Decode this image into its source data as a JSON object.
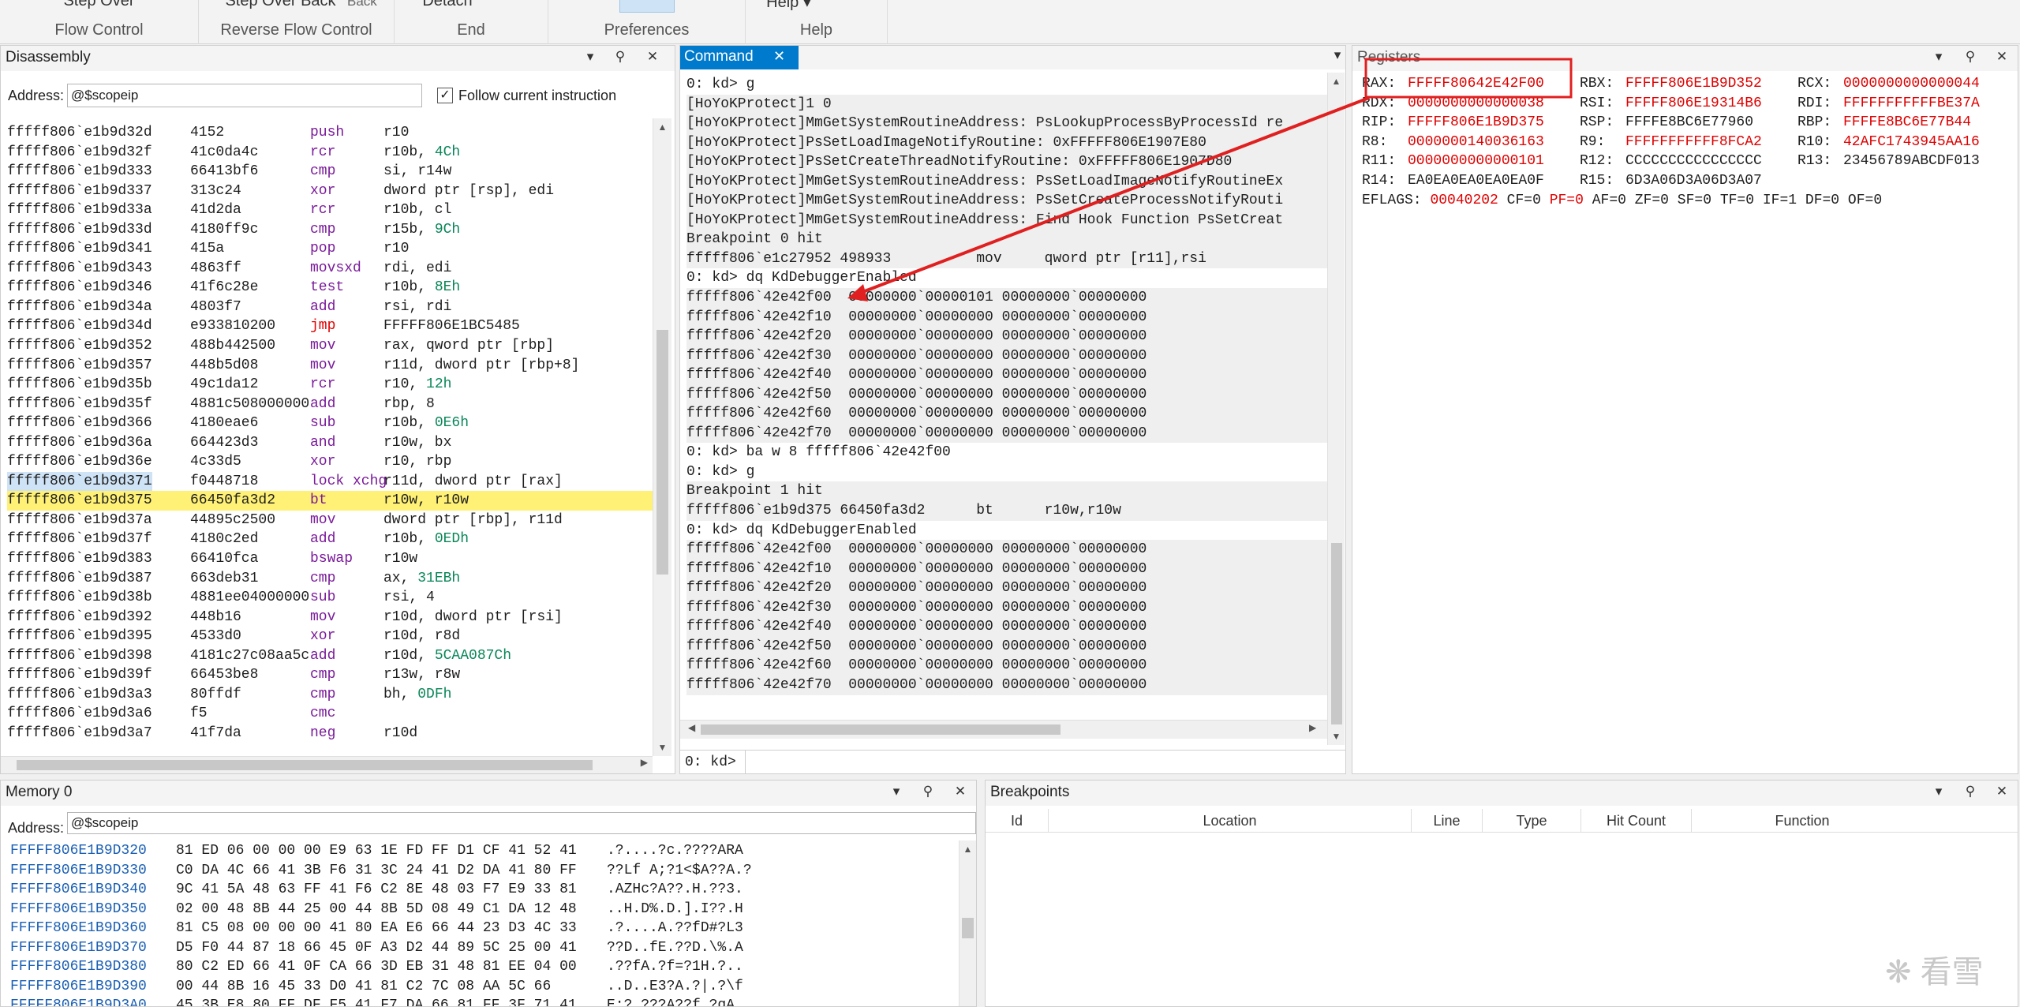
{
  "ribbon": {
    "groups": [
      {
        "top": "Step Over",
        "caption": "Flow Control"
      },
      {
        "top": "Step Over Back",
        "caption": "Reverse Flow Control"
      },
      {
        "top": "Detach",
        "caption": "End"
      },
      {
        "top": "",
        "caption": "Preferences"
      },
      {
        "top": "Help",
        "caption": "Help"
      }
    ],
    "back_label": "Back"
  },
  "disassembly": {
    "title": "Disassembly",
    "address_label": "Address:",
    "address_value": "@$scopeip",
    "follow_label": "Follow current instruction",
    "rows": [
      {
        "a": "fffff806`e1b9d32d",
        "b": "4152",
        "m": "push",
        "o": "r10",
        "h": "",
        "k": "p"
      },
      {
        "a": "fffff806`e1b9d32f",
        "b": "41c0da4c",
        "m": "rcr",
        "o": "r10b, ",
        "h": "4Ch",
        "k": "p"
      },
      {
        "a": "fffff806`e1b9d333",
        "b": "66413bf6",
        "m": "cmp",
        "o": "si, r14w",
        "h": "",
        "k": "p"
      },
      {
        "a": "fffff806`e1b9d337",
        "b": "313c24",
        "m": "xor",
        "o": "dword ptr [rsp], edi",
        "h": "",
        "k": "p"
      },
      {
        "a": "fffff806`e1b9d33a",
        "b": "41d2da",
        "m": "rcr",
        "o": "r10b, cl",
        "h": "",
        "k": "p"
      },
      {
        "a": "fffff806`e1b9d33d",
        "b": "4180ff9c",
        "m": "cmp",
        "o": "r15b, ",
        "h": "9Ch",
        "k": "p"
      },
      {
        "a": "fffff806`e1b9d341",
        "b": "415a",
        "m": "pop",
        "o": "r10",
        "h": "",
        "k": "p"
      },
      {
        "a": "fffff806`e1b9d343",
        "b": "4863ff",
        "m": "movsxd",
        "o": "rdi, edi",
        "h": "",
        "k": "p"
      },
      {
        "a": "fffff806`e1b9d346",
        "b": "41f6c28e",
        "m": "test",
        "o": "r10b, ",
        "h": "8Eh",
        "k": "p"
      },
      {
        "a": "fffff806`e1b9d34a",
        "b": "4803f7",
        "m": "add",
        "o": "rsi, rdi",
        "h": "",
        "k": "p"
      },
      {
        "a": "fffff806`e1b9d34d",
        "b": "e933810200",
        "m": "jmp",
        "o": "FFFFF806E1BC5485",
        "h": "",
        "k": "r"
      },
      {
        "a": "fffff806`e1b9d352",
        "b": "488b442500",
        "m": "mov",
        "o": "rax, qword ptr [rbp]",
        "h": "",
        "k": "p"
      },
      {
        "a": "fffff806`e1b9d357",
        "b": "448b5d08",
        "m": "mov",
        "o": "r11d, dword ptr [rbp+8]",
        "h": "",
        "k": "p"
      },
      {
        "a": "fffff806`e1b9d35b",
        "b": "49c1da12",
        "m": "rcr",
        "o": "r10, ",
        "h": "12h",
        "k": "p"
      },
      {
        "a": "fffff806`e1b9d35f",
        "b": "4881c508000000",
        "m": "add",
        "o": "rbp, 8",
        "h": "",
        "k": "p"
      },
      {
        "a": "fffff806`e1b9d366",
        "b": "4180eae6",
        "m": "sub",
        "o": "r10b, ",
        "h": "0E6h",
        "k": "p"
      },
      {
        "a": "fffff806`e1b9d36a",
        "b": "664423d3",
        "m": "and",
        "o": "r10w, bx",
        "h": "",
        "k": "p"
      },
      {
        "a": "fffff806`e1b9d36e",
        "b": "4c33d5",
        "m": "xor",
        "o": "r10, rbp",
        "h": "",
        "k": "p"
      },
      {
        "a": "fffff806`e1b9d371",
        "b": "f0448718",
        "m": "lock xchg",
        "o": "r11d, dword ptr [rax]",
        "h": "",
        "k": "p"
      },
      {
        "a": "fffff806`e1b9d375",
        "b": "66450fa3d2",
        "m": "bt",
        "o": "r10w, r10w",
        "h": "",
        "k": "p"
      },
      {
        "a": "fffff806`e1b9d37a",
        "b": "44895c2500",
        "m": "mov",
        "o": "dword ptr [rbp], r11d",
        "h": "",
        "k": "p"
      },
      {
        "a": "fffff806`e1b9d37f",
        "b": "4180c2ed",
        "m": "add",
        "o": "r10b, ",
        "h": "0EDh",
        "k": "p"
      },
      {
        "a": "fffff806`e1b9d383",
        "b": "66410fca",
        "m": "bswap",
        "o": "r10w",
        "h": "",
        "k": "p"
      },
      {
        "a": "fffff806`e1b9d387",
        "b": "663deb31",
        "m": "cmp",
        "o": "ax, ",
        "h": "31EBh",
        "k": "p"
      },
      {
        "a": "fffff806`e1b9d38b",
        "b": "4881ee04000000",
        "m": "sub",
        "o": "rsi, 4",
        "h": "",
        "k": "p"
      },
      {
        "a": "fffff806`e1b9d392",
        "b": "448b16",
        "m": "mov",
        "o": "r10d, dword ptr [rsi]",
        "h": "",
        "k": "p"
      },
      {
        "a": "fffff806`e1b9d395",
        "b": "4533d0",
        "m": "xor",
        "o": "r10d, r8d",
        "h": "",
        "k": "p"
      },
      {
        "a": "fffff806`e1b9d398",
        "b": "4181c27c08aa5c",
        "m": "add",
        "o": "r10d, ",
        "h": "5CAA087Ch",
        "k": "p"
      },
      {
        "a": "fffff806`e1b9d39f",
        "b": "66453be8",
        "m": "cmp",
        "o": "r13w, r8w",
        "h": "",
        "k": "p"
      },
      {
        "a": "fffff806`e1b9d3a3",
        "b": "80ffdf",
        "m": "cmp",
        "o": "bh, ",
        "h": "0DFh",
        "k": "p"
      },
      {
        "a": "fffff806`e1b9d3a6",
        "b": "f5",
        "m": "cmc",
        "o": "",
        "h": "",
        "k": "p"
      },
      {
        "a": "fffff806`e1b9d3a7",
        "b": "41f7da",
        "m": "neg",
        "o": "r10d",
        "h": "",
        "k": "p"
      }
    ]
  },
  "command": {
    "tab_label": "Command",
    "prompt": "0: kd>",
    "lines": [
      {
        "t": "0: kd> g",
        "bg": "w"
      },
      {
        "t": "[HoYoKProtect]1 0",
        "bg": "g"
      },
      {
        "t": "[HoYoKProtect]MmGetSystemRoutineAddress: PsLookupProcessByProcessId re",
        "bg": "g"
      },
      {
        "t": "[HoYoKProtect]PsSetLoadImageNotifyRoutine: 0xFFFFF806E1907E80",
        "bg": "g"
      },
      {
        "t": "[HoYoKProtect]PsSetCreateThreadNotifyRoutine: 0xFFFFF806E1907D80",
        "bg": "g"
      },
      {
        "t": "[HoYoKProtect]MmGetSystemRoutineAddress: PsSetLoadImageNotifyRoutineEx",
        "bg": "g"
      },
      {
        "t": "[HoYoKProtect]MmGetSystemRoutineAddress: PsSetCreateProcessNotifyRouti",
        "bg": "g"
      },
      {
        "t": "[HoYoKProtect]MmGetSystemRoutineAddress: Find Hook Function PsSetCreat",
        "bg": "g"
      },
      {
        "t": "Breakpoint 0 hit",
        "bg": "g"
      },
      {
        "t": "fffff806`e1c27952 498933          mov     qword ptr [r11],rsi",
        "bg": "g"
      },
      {
        "t": "0: kd> dq KdDebuggerEnabled",
        "bg": "w"
      },
      {
        "t": "fffff806`42e42f00  00000000`00000101 00000000`00000000",
        "bg": "g"
      },
      {
        "t": "fffff806`42e42f10  00000000`00000000 00000000`00000000",
        "bg": "g"
      },
      {
        "t": "fffff806`42e42f20  00000000`00000000 00000000`00000000",
        "bg": "g"
      },
      {
        "t": "fffff806`42e42f30  00000000`00000000 00000000`00000000",
        "bg": "g"
      },
      {
        "t": "fffff806`42e42f40  00000000`00000000 00000000`00000000",
        "bg": "g"
      },
      {
        "t": "fffff806`42e42f50  00000000`00000000 00000000`00000000",
        "bg": "g"
      },
      {
        "t": "fffff806`42e42f60  00000000`00000000 00000000`00000000",
        "bg": "g"
      },
      {
        "t": "fffff806`42e42f70  00000000`00000000 00000000`00000000",
        "bg": "g"
      },
      {
        "t": "0: kd> ba w 8 fffff806`42e42f00",
        "bg": "w"
      },
      {
        "t": "0: kd> g",
        "bg": "w"
      },
      {
        "t": "Breakpoint 1 hit",
        "bg": "g"
      },
      {
        "t": "fffff806`e1b9d375 66450fa3d2      bt      r10w,r10w",
        "bg": "g"
      },
      {
        "t": "0: kd> dq KdDebuggerEnabled",
        "bg": "w"
      },
      {
        "t": "fffff806`42e42f00  00000000`00000000 00000000`00000000",
        "bg": "g"
      },
      {
        "t": "fffff806`42e42f10  00000000`00000000 00000000`00000000",
        "bg": "g"
      },
      {
        "t": "fffff806`42e42f20  00000000`00000000 00000000`00000000",
        "bg": "g"
      },
      {
        "t": "fffff806`42e42f30  00000000`00000000 00000000`00000000",
        "bg": "g"
      },
      {
        "t": "fffff806`42e42f40  00000000`00000000 00000000`00000000",
        "bg": "g"
      },
      {
        "t": "fffff806`42e42f50  00000000`00000000 00000000`00000000",
        "bg": "g"
      },
      {
        "t": "fffff806`42e42f60  00000000`00000000 00000000`00000000",
        "bg": "g"
      },
      {
        "t": "fffff806`42e42f70  00000000`00000000 00000000`00000000",
        "bg": "g"
      }
    ]
  },
  "registers": {
    "title": "Registers",
    "rows": [
      [
        {
          "n": "RAX:",
          "v": "FFFFF80642E42F00",
          "c": "r"
        },
        {
          "n": "RBX:",
          "v": "FFFFF806E1B9D352",
          "c": "r"
        },
        {
          "n": "RCX:",
          "v": "0000000000000044",
          "c": "r"
        }
      ],
      [
        {
          "n": "RDX:",
          "v": "0000000000000038",
          "c": "r"
        },
        {
          "n": "RSI:",
          "v": "FFFFF806E19314B6",
          "c": "r"
        },
        {
          "n": "RDI:",
          "v": "FFFFFFFFFFFBE37A",
          "c": "r"
        }
      ],
      [
        {
          "n": "RIP:",
          "v": "FFFFF806E1B9D375",
          "c": "r"
        },
        {
          "n": "RSP:",
          "v": "FFFFE8BC6E77960",
          "c": "k"
        },
        {
          "n": "RBP:",
          "v": "FFFFE8BC6E77B44",
          "c": "r"
        }
      ],
      [
        {
          "n": "R8:",
          "v": "0000000140036163",
          "c": "r"
        },
        {
          "n": "R9:",
          "v": "FFFFFFFFFFF8FCA2",
          "c": "r"
        },
        {
          "n": "R10:",
          "v": "42AFC1743945AA16",
          "c": "r"
        }
      ],
      [
        {
          "n": "R11:",
          "v": "0000000000000101",
          "c": "r"
        },
        {
          "n": "R12:",
          "v": "CCCCCCCCCCCCCCCC",
          "c": "k"
        },
        {
          "n": "R13:",
          "v": "23456789ABCDF013",
          "c": "k"
        }
      ],
      [
        {
          "n": "R14:",
          "v": "EA0EA0EA0EA0EA0F",
          "c": "k"
        },
        {
          "n": "R15:",
          "v": "6D3A06D3A06D3A07",
          "c": "k"
        }
      ]
    ],
    "eflags_label": "EFLAGS:",
    "eflags_value": "00040202",
    "flags": [
      {
        "t": "CF=0",
        "c": "k"
      },
      {
        "t": "PF=0",
        "c": "r"
      },
      {
        "t": "AF=0",
        "c": "k"
      },
      {
        "t": "ZF=0",
        "c": "k"
      },
      {
        "t": "SF=0",
        "c": "k"
      },
      {
        "t": "TF=0",
        "c": "k"
      },
      {
        "t": "IF=1",
        "c": "k"
      },
      {
        "t": "DF=0",
        "c": "k"
      },
      {
        "t": "OF=0",
        "c": "k"
      }
    ]
  },
  "memory": {
    "title": "Memory 0",
    "address_label": "Address:",
    "address_value": "@$scopeip",
    "rows": [
      {
        "a": "FFFFF806E1B9D320",
        "h": "81 ED 06 00 00 00 E9 63 1E FD FF D1 CF 41 52 41",
        "s": ".?....?c.????ARA"
      },
      {
        "a": "FFFFF806E1B9D330",
        "h": "C0 DA 4C 66 41 3B F6 31 3C 24 41 D2 DA 41 80 FF",
        "s": "??Lf A;?1<$A??A.?"
      },
      {
        "a": "FFFFF806E1B9D340",
        "h": "9C 41 5A 48 63 FF 41 F6 C2 8E 48 03 F7 E9 33 81",
        "s": ".AZHc?A??.H.??3."
      },
      {
        "a": "FFFFF806E1B9D350",
        "h": "02 00 48 8B 44 25 00 44 8B 5D 08 49 C1 DA 12 48",
        "s": "..H.D%.D.].I??.H"
      },
      {
        "a": "FFFFF806E1B9D360",
        "h": "81 C5 08 00 00 00 41 80 EA E6 66 44 23 D3 4C 33",
        "s": ".?....A.??fD#?L3"
      },
      {
        "a": "FFFFF806E1B9D370",
        "h": "D5 F0 44 87 18 66 45 0F A3 D2 44 89 5C 25 00 41",
        "s": "??D..fE.??D.\\%.A"
      },
      {
        "a": "FFFFF806E1B9D380",
        "h": "80 C2 ED 66 41 0F CA 66 3D EB 31 48 81 EE 04 00",
        "s": ".??fA.?f=?1H.?.."
      },
      {
        "a": "FFFFF806E1B9D390",
        "h": "00 44 8B 16 45 33 D0 41 81 C2 7C 08 AA 5C 66",
        "s": "..D..E3?A.?|.?\\f"
      },
      {
        "a": "FFFFF806E1B9D3A0",
        "h": "45 3B E8 80 FF DF F5 41 F7 DA 66 81 FF 3F 71 41",
        "s": "E;?.???A??f.?qA"
      }
    ]
  },
  "breakpoints": {
    "title": "Breakpoints",
    "columns": [
      "Id",
      "Location",
      "Line",
      "Type",
      "Hit Count",
      "Function"
    ]
  },
  "watermark": "看雪",
  "colors": {
    "accent": "#007acc",
    "highlight": "#fff176",
    "annotation": "#e02020",
    "value_red": "#e00000",
    "number_green": "#098658",
    "mnemonic_purple": "#7a1a9a"
  }
}
